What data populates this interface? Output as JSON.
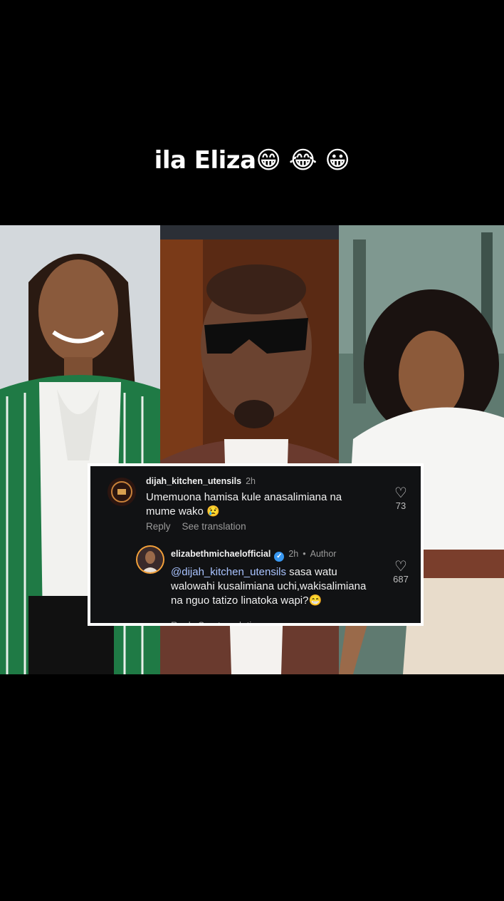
{
  "caption": {
    "text": "ila Eliza😁 😂 😀"
  },
  "comments": [
    {
      "username": "dijah_kitchen_utensils",
      "time": "2h",
      "text": "Umemuona hamisa kule anasalimiana na mume wako 😢",
      "reply_label": "Reply",
      "translate_label": "See translation",
      "likes": "73",
      "avatar_icon": "kitchen-logo-avatar"
    },
    {
      "username": "elizabethmichaelofficial",
      "verified_icon": "verified-badge-icon",
      "time": "2h",
      "author_label": "Author",
      "mention": "@dijah_kitchen_utensils",
      "text": "sasa watu walowahi kusalimiana uchi,wakisalimiana na nguo tatizo linatoka wapi?😁",
      "actions_label": "Reply    See translation",
      "likes": "687",
      "avatar_icon": "profile-photo-avatar"
    }
  ],
  "colors": {
    "background": "#000000",
    "card": "#111214",
    "mention": "#a9c3ff",
    "verified": "#3897f0"
  }
}
